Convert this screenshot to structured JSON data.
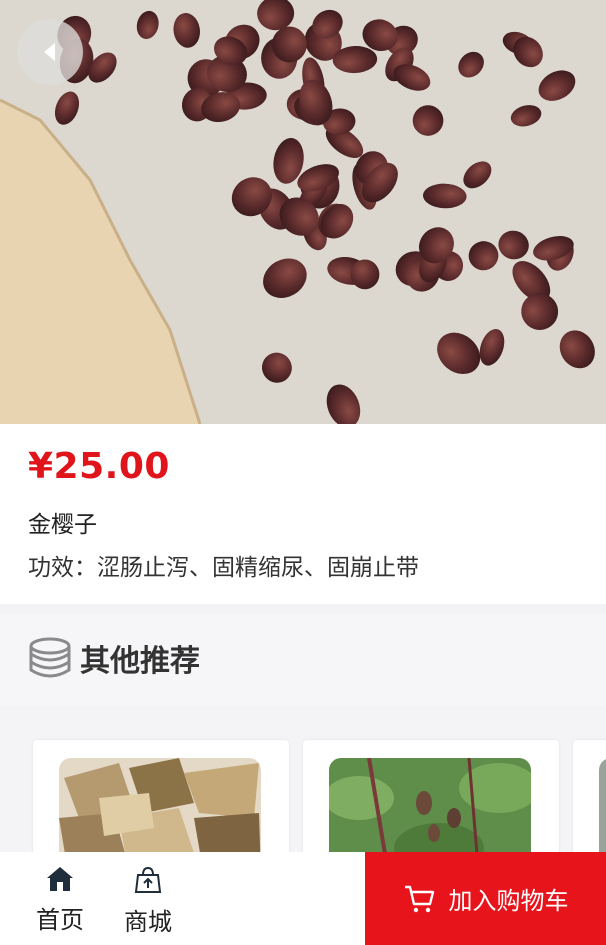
{
  "product": {
    "price": "¥25.00",
    "name": "金樱子",
    "efficacy": "功效：涩肠止泻、固精缩尿、固崩止带",
    "image_icon": "dried-rosehip-photo"
  },
  "recommend": {
    "title": "其他推荐",
    "icon": "coin-stack-icon",
    "items": [
      {
        "image_icon": "dried-bark-photo"
      },
      {
        "image_icon": "green-plant-photo"
      },
      {
        "image_icon": "partial-card"
      }
    ]
  },
  "nav": {
    "home_label": "首页",
    "home_icon": "home-icon",
    "mall_label": "商城",
    "mall_icon": "shopping-bag-icon",
    "cart_label": "加入购物车",
    "cart_icon": "cart-icon"
  },
  "colors": {
    "price": "#e0141b",
    "cart_button": "#e8141c",
    "section_bg": "#f6f6f8"
  }
}
